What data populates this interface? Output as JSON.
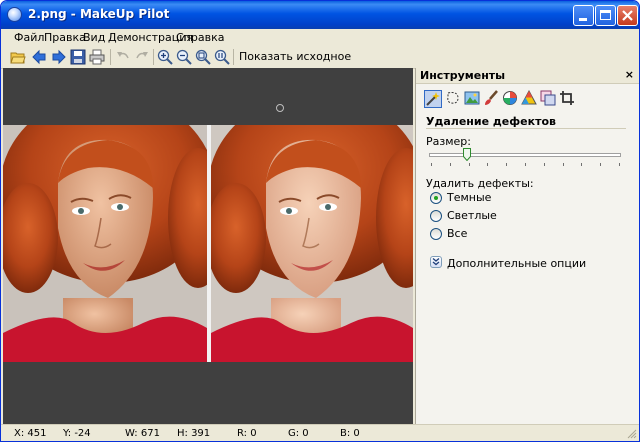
{
  "window": {
    "title": "2.png - MakeUp Pilot",
    "colors": {
      "titlebar": "#0054e3",
      "face": "#ece9d8",
      "canvas": "#404040",
      "close": "#c4391d"
    }
  },
  "menu": {
    "items": [
      "Файл",
      "Правка",
      "Вид",
      "Демонстрация",
      "Справка"
    ]
  },
  "toolbar": {
    "icons": [
      "open-folder-icon",
      "back-arrow-icon",
      "forward-arrow-icon",
      "save-icon",
      "print-icon",
      "undo-icon",
      "redo-icon",
      "zoom-in-icon",
      "zoom-out-icon",
      "zoom-fit-icon",
      "zoom-actual-icon"
    ],
    "show_original_label": "Показать исходное"
  },
  "panel": {
    "title": "Инструменты",
    "close_glyph": "×",
    "tools": [
      "defect-removal-tool-icon",
      "selection-tool-icon",
      "image-tool-icon",
      "brush-tool-icon",
      "color-tool-icon",
      "color-triangle-tool-icon",
      "layers-tool-icon",
      "crop-tool-icon"
    ],
    "section_title": "Удаление дефектов",
    "size_label": "Размер:",
    "size_value_fraction": 0.2,
    "remove_label": "Удалить дефекты:",
    "options": [
      "Темные",
      "Светлые",
      "Все"
    ],
    "selected_option": "Темные",
    "extra_options_label": "Дополнительные опции"
  },
  "status": {
    "x": "X: 451",
    "y": "Y: -24",
    "w": "W: 671",
    "h": "H: 391",
    "r": "R: 0",
    "g": "G: 0",
    "b": "B: 0"
  }
}
